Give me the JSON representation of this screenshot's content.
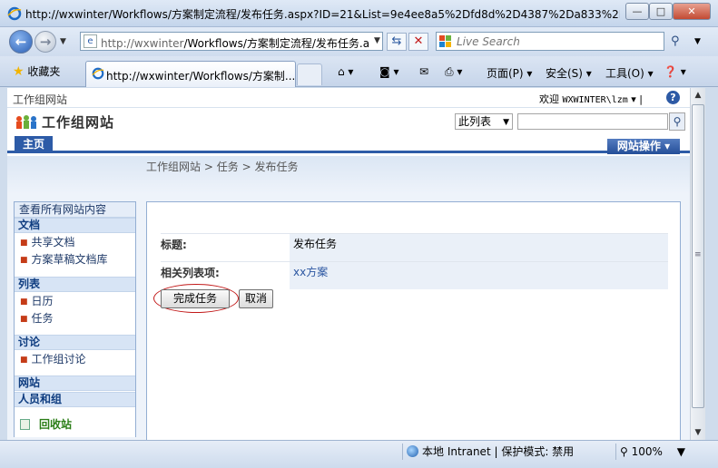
{
  "window": {
    "title": "http://wxwinter/Workflows/方案制定流程/发布任务.aspx?ID=21&List=9e4ee8a5%2Dfd8d%2D4387%2Da833%2D...",
    "min_glyph": "—",
    "max_glyph": "□",
    "close_glyph": "✕"
  },
  "addressbar": {
    "url_host": "http://wxwinter",
    "url_path": "/Workflows/方案制定流程/发布任务.a",
    "search_placeholder": "Live Search"
  },
  "tabs": {
    "favorites_label": "收藏夹",
    "active_tab_label": "http://wxwinter/Workflows/方案制...",
    "commands": [
      "页面(P)",
      "安全(S)",
      "工具(O)"
    ]
  },
  "sharepoint": {
    "breadcrumb_top": "工作组网站",
    "welcome_prefix": "欢迎 ",
    "welcome_user": "WXWINTER\\lzm",
    "site_title": "工作组网站",
    "search_scope": "此列表",
    "home_tab": "主页",
    "site_actions": "网站操作",
    "page_breadcrumb": [
      "工作组网站",
      "任务",
      "发布任务"
    ],
    "breadcrumb_sep": ">"
  },
  "quicklaunch": {
    "view_all": "查看所有网站内容",
    "sections": [
      {
        "header": "文档",
        "items": [
          "共享文档",
          "方案草稿文档库"
        ]
      },
      {
        "header": "列表",
        "items": [
          "日历",
          "任务"
        ]
      },
      {
        "header": "讨论",
        "items": [
          "工作组讨论"
        ]
      },
      {
        "header": "网站",
        "items": []
      },
      {
        "header": "人员和组",
        "items": []
      }
    ],
    "recycle_bin": "回收站"
  },
  "form": {
    "rows": [
      {
        "label": "标题:",
        "value": "发布任务"
      },
      {
        "label": "相关列表项:",
        "value": "xx方案"
      }
    ],
    "complete_button": "完成任务",
    "cancel_button": "取消"
  },
  "statusbar": {
    "zone": "本地 Intranet | 保护模式: 禁用",
    "zoom": "100%"
  }
}
